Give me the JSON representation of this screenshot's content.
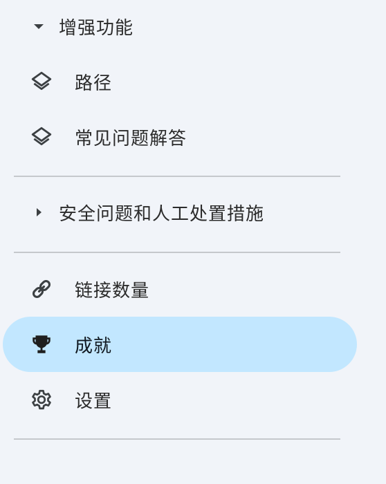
{
  "navigation": {
    "enhanced_section": {
      "label": "增强功能",
      "expanded": true,
      "items": [
        {
          "label": "路径",
          "icon": "layers-icon"
        },
        {
          "label": "常见问题解答",
          "icon": "layers-icon"
        }
      ]
    },
    "safety_section": {
      "label": "安全问题和人工处置措施",
      "expanded": false
    },
    "bottom_items": [
      {
        "label": "链接数量",
        "icon": "link-icon",
        "active": false
      },
      {
        "label": "成就",
        "icon": "trophy-icon",
        "active": true
      },
      {
        "label": "设置",
        "icon": "gear-icon",
        "active": false
      }
    ]
  },
  "colors": {
    "background": "#f1f4f9",
    "active_item": "#c2e7ff",
    "divider": "#c5c8cc",
    "icon": "#3c4043"
  }
}
